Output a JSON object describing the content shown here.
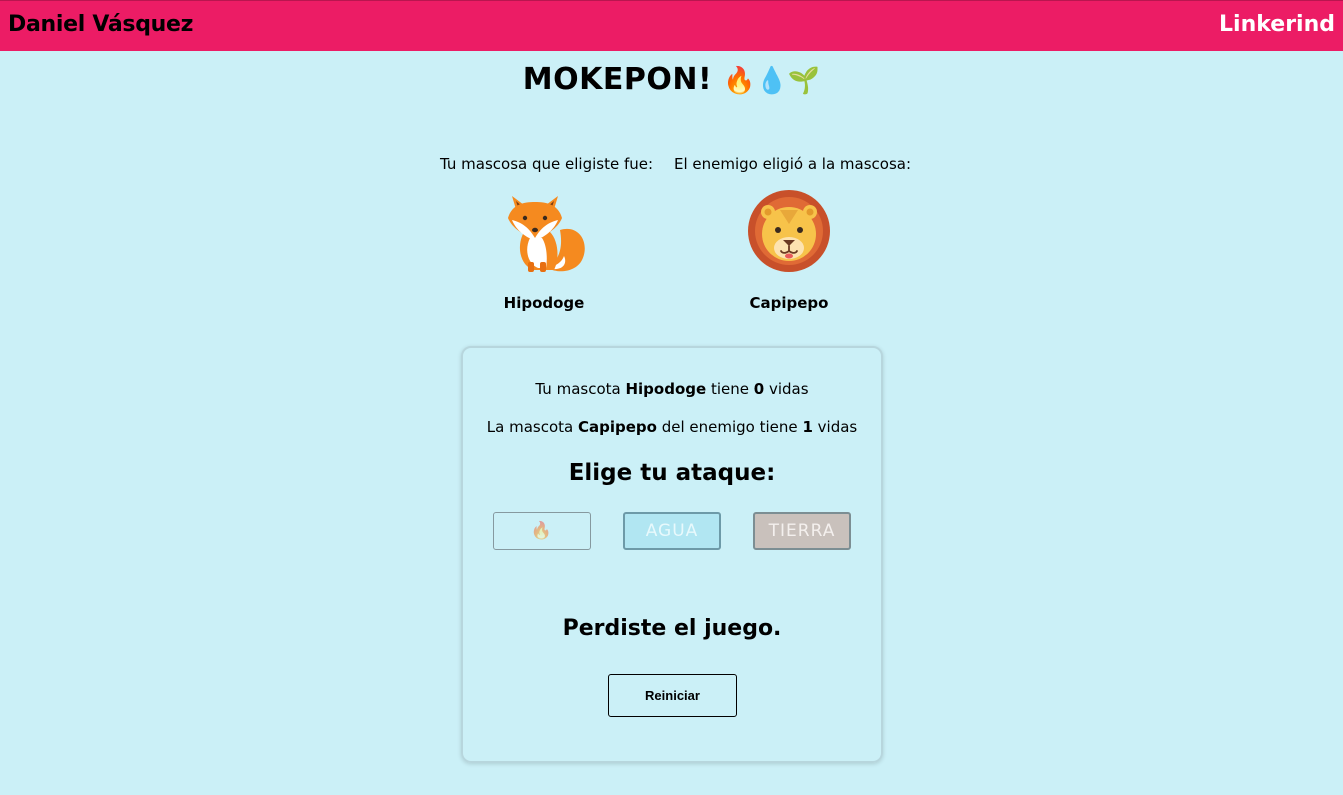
{
  "header": {
    "author": "Daniel Vásquez",
    "link_label": "Linkerind",
    "bar_color": "#ec1c65"
  },
  "title": {
    "text": "MOKEPON!",
    "emojis": "🔥💧🌱"
  },
  "pets": {
    "player_caption": "Tu mascosa que eligiste fue:",
    "enemy_caption": "El enemigo eligió a la mascosa:",
    "player_name": "Hipodoge",
    "enemy_name": "Capipepo",
    "player_icon": "fox-icon",
    "enemy_icon": "lion-icon"
  },
  "status": {
    "player_prefix": "Tu mascota",
    "player_pet": "Hipodoge",
    "player_mid": "tiene",
    "player_lives": "0",
    "player_suffix": "vidas",
    "enemy_prefix": "La mascota",
    "enemy_pet": "Capipepo",
    "enemy_mid": "del enemigo tiene",
    "enemy_lives": "1",
    "enemy_suffix": "vidas"
  },
  "attacks": {
    "title": "Elige tu ataque:",
    "fire_label": "🔥",
    "water_label": "AGUA",
    "earth_label": "TIERRA"
  },
  "result": {
    "message": "Perdiste el juego.",
    "restart_label": "Reiniciar"
  },
  "colors": {
    "background": "#cbf0f7",
    "water_button": "#b1e6f2",
    "earth_button": "#c9c1bc"
  }
}
